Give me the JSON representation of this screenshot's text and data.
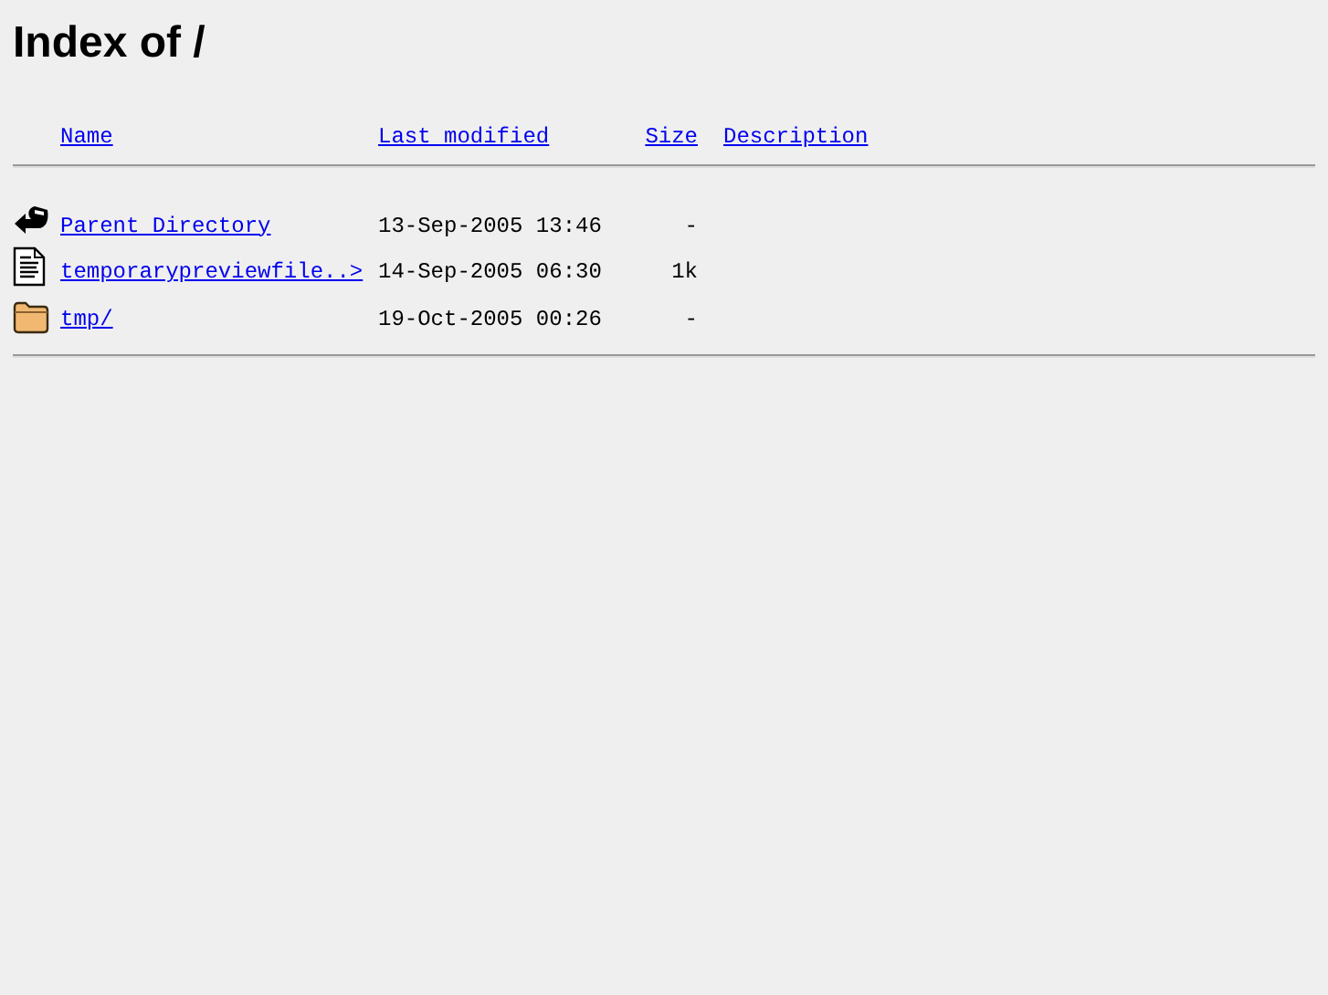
{
  "title": "Index of /",
  "columns": [
    "Name",
    "Last modified",
    "Size",
    "Description"
  ],
  "rows": [
    {
      "kind": "back",
      "name": "Parent Directory",
      "modified": "13-Sep-2005 13:46",
      "size": "-"
    },
    {
      "kind": "text",
      "name": "temporarypreviewfile..>",
      "modified": "14-Sep-2005 06:30",
      "size": "1k"
    },
    {
      "kind": "folder",
      "name": "tmp/",
      "modified": "19-Oct-2005 00:26",
      "size": "-"
    }
  ]
}
